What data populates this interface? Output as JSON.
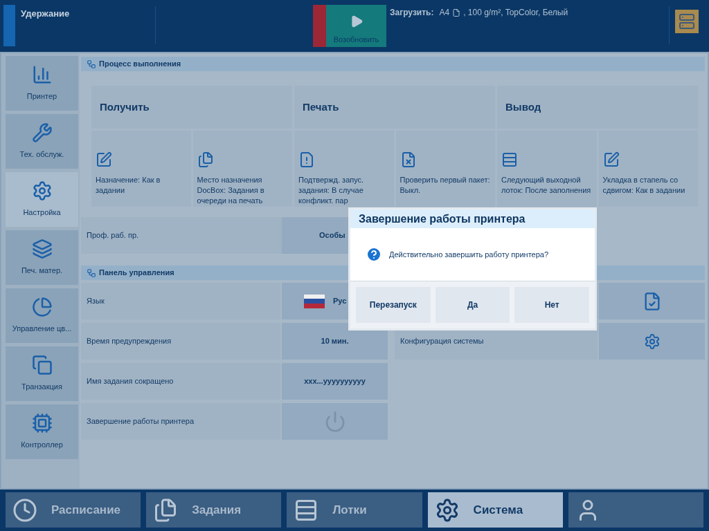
{
  "status": {
    "title": "Удержание"
  },
  "resume_button": {
    "label": "Возобновить"
  },
  "load": {
    "label": "Загрузить:",
    "size": "A4",
    "details": ", 100 g/m², TopColor, Белый"
  },
  "sidebar": {
    "items": [
      {
        "label": "Принтер",
        "selected": false
      },
      {
        "label": "Тех. обслуж.",
        "selected": false
      },
      {
        "label": "Настройка",
        "selected": true
      },
      {
        "label": "Печ. матер.",
        "selected": false
      },
      {
        "label": "Управление цв...",
        "selected": false
      },
      {
        "label": "Транзакция",
        "selected": false
      },
      {
        "label": "Контроллер",
        "selected": false
      }
    ]
  },
  "workflow": {
    "title": "Процесс выполнения",
    "groups": [
      {
        "title": "Получить",
        "items": [
          {
            "label": "Назначение: Как в задании"
          },
          {
            "label": "Место назначения DocBox: Задания в очереди на печать"
          }
        ]
      },
      {
        "title": "Печать",
        "items": [
          {
            "label": "Подтвержд. запус. задания: В случае конфликт. пар"
          },
          {
            "label": "Проверить первый пакет: Выкл."
          }
        ]
      },
      {
        "title": "Вывод",
        "items": [
          {
            "label": "Следующий выходной лоток: После заполнения"
          },
          {
            "label": "Укладка в стапель со сдвигом: Как в задании"
          }
        ]
      }
    ],
    "profile": {
      "label": "Проф. раб. пр.",
      "value": "Особы"
    }
  },
  "control_panel": {
    "title": "Панель управления",
    "left_rows": [
      {
        "label": "Язык",
        "kind": "flag",
        "value": "Рус"
      },
      {
        "label": "Время предупреждения",
        "kind": "text",
        "value": "10 мин."
      },
      {
        "label": "Имя задания сокращено",
        "kind": "text",
        "value": "xxx...yyyyyyyyyy"
      },
      {
        "label": "Завершение работы принтера",
        "kind": "power"
      }
    ],
    "right_rows": [
      {
        "kind": "doc-check"
      },
      {
        "label": "Конфигурация системы",
        "kind": "gear"
      }
    ]
  },
  "dialog": {
    "title": "Завершение работы принтера",
    "message": "Действительно завершить работу принтера?",
    "buttons": [
      "Перезапуск",
      "Да",
      "Нет"
    ]
  },
  "bottom_tabs": [
    {
      "label": "Расписание",
      "selected": false
    },
    {
      "label": "Задания",
      "selected": false
    },
    {
      "label": "Лотки",
      "selected": false
    },
    {
      "label": "Система",
      "selected": true
    },
    {
      "selected": false
    }
  ]
}
